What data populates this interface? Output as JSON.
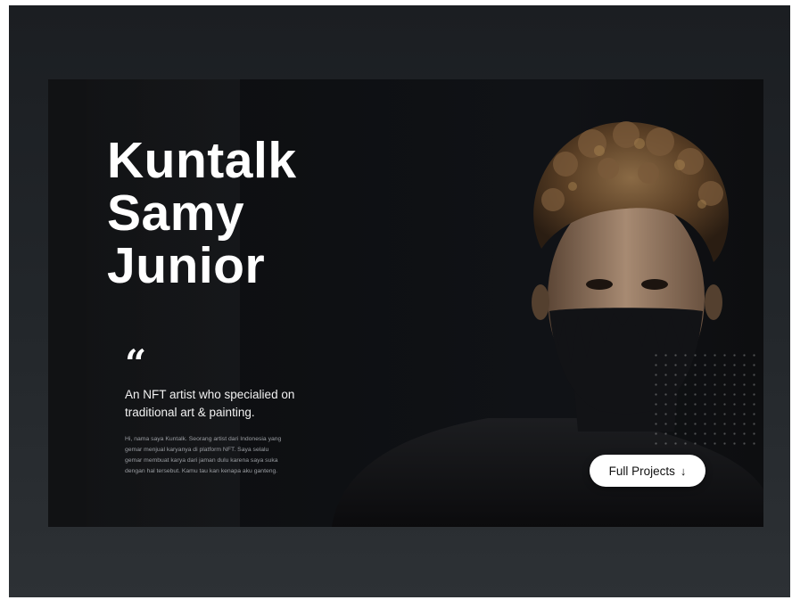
{
  "hero": {
    "title_lines": [
      "Kuntalk",
      "Samy",
      "Junior"
    ],
    "quote_glyph": "“",
    "tagline": "An NFT artist who specialied on traditional art & painting.",
    "bio": "Hi, nama saya Kuntalk. Seorang artist dari Indonesia yang gemar menjual karyanya di platform NFT. Saya selalu gemar membuat karya dari jaman dulu karena saya suka dengan hal tersebut. Kamu tau kan kenapa aku ganteng.",
    "cta_label": "Full Projects",
    "cta_icon": "arrow-down-icon",
    "cta_arrow": "↓"
  },
  "colors": {
    "background": "#1f2226",
    "hero_background": "#0e1013",
    "text_primary": "#ffffff",
    "text_muted": "#9a9da2",
    "button_background": "#ffffff",
    "button_text": "#111111"
  }
}
